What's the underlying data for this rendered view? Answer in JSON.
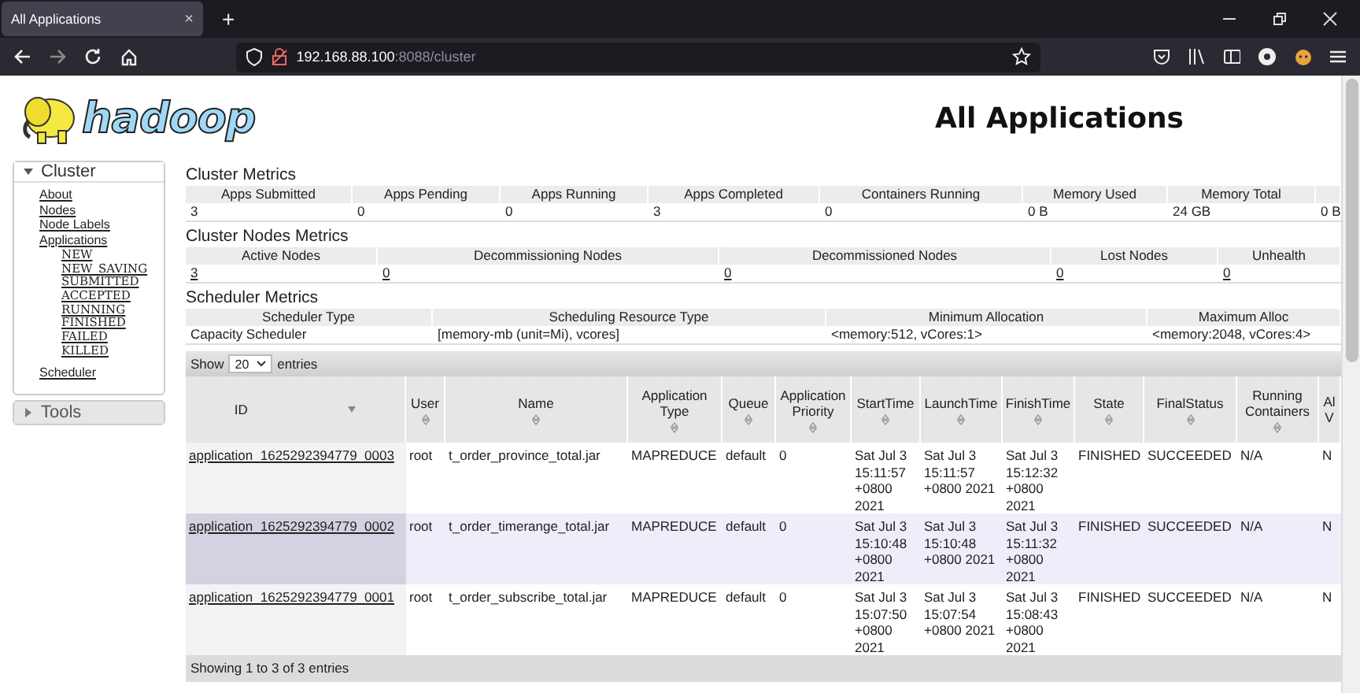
{
  "browser": {
    "tab_title": "All Applications",
    "tab_close": "×",
    "new_tab": "+",
    "url_host": "192.168.88.100",
    "url_path": ":8088/cluster"
  },
  "header": {
    "logo_text": "hadoop",
    "title": "All Applications"
  },
  "sidebar": [
    {
      "label": "Cluster",
      "expanded": true,
      "items": [
        {
          "label": "About"
        },
        {
          "label": "Nodes"
        },
        {
          "label": "Node Labels"
        },
        {
          "label": "Applications",
          "children": [
            {
              "label": "NEW"
            },
            {
              "label": "NEW_SAVING"
            },
            {
              "label": "SUBMITTED"
            },
            {
              "label": "ACCEPTED"
            },
            {
              "label": "RUNNING"
            },
            {
              "label": "FINISHED"
            },
            {
              "label": "FAILED"
            },
            {
              "label": "KILLED"
            }
          ]
        },
        {
          "label": "Scheduler"
        }
      ]
    },
    {
      "label": "Tools",
      "expanded": false
    }
  ],
  "metrics": [
    {
      "title": "Cluster Metrics",
      "columns": [
        "Apps Submitted",
        "Apps Pending",
        "Apps Running",
        "Apps Completed",
        "Containers Running",
        "Memory Used",
        "Memory Total",
        ""
      ],
      "values": [
        "3",
        "0",
        "0",
        "3",
        "0",
        "0 B",
        "24 GB",
        "0 B"
      ],
      "links": false
    },
    {
      "title": "Cluster Nodes Metrics",
      "columns": [
        "Active Nodes",
        "Decommissioning Nodes",
        "Decommissioned Nodes",
        "Lost Nodes",
        "Unhealth"
      ],
      "values": [
        "3",
        "0",
        "0",
        "0",
        "0"
      ],
      "links": true
    },
    {
      "title": "Scheduler Metrics",
      "columns": [
        "Scheduler Type",
        "Scheduling Resource Type",
        "Minimum Allocation",
        "Maximum Alloc"
      ],
      "values": [
        "Capacity Scheduler",
        "[memory-mb (unit=Mi), vcores]",
        "<memory:512, vCores:1>",
        "<memory:2048, vCores:4>"
      ],
      "links": false
    }
  ],
  "apps": {
    "show_label": "Show",
    "page_size": "20",
    "entries_label": "entries",
    "columns": [
      {
        "label": "ID",
        "sorted": true
      },
      {
        "label": "User",
        "sorted": false
      },
      {
        "label": "Name",
        "sorted": false
      },
      {
        "label": "Application Type",
        "sorted": false
      },
      {
        "label": "Queue",
        "sorted": false
      },
      {
        "label": "Application Priority",
        "sorted": false
      },
      {
        "label": "StartTime",
        "sorted": false
      },
      {
        "label": "LaunchTime",
        "sorted": false
      },
      {
        "label": "FinishTime",
        "sorted": false
      },
      {
        "label": "State",
        "sorted": false
      },
      {
        "label": "FinalStatus",
        "sorted": false
      },
      {
        "label": "Running Containers",
        "sorted": false
      },
      {
        "label": "Al V"
      }
    ],
    "rows": [
      {
        "selected": false,
        "cells": [
          "application_1625292394779_0003",
          "root",
          "t_order_province_total.jar",
          "MAPREDUCE",
          "default",
          "0",
          "Sat Jul 3 15:11:57 +0800 2021",
          "Sat Jul 3 15:11:57 +0800 2021",
          "Sat Jul 3 15:12:32 +0800 2021",
          "FINISHED",
          "SUCCEEDED",
          "N/A",
          "N"
        ]
      },
      {
        "selected": true,
        "cells": [
          "application_1625292394779_0002",
          "root",
          "t_order_timerange_total.jar",
          "MAPREDUCE",
          "default",
          "0",
          "Sat Jul 3 15:10:48 +0800 2021",
          "Sat Jul 3 15:10:48 +0800 2021",
          "Sat Jul 3 15:11:32 +0800 2021",
          "FINISHED",
          "SUCCEEDED",
          "N/A",
          "N"
        ]
      },
      {
        "selected": false,
        "cells": [
          "application_1625292394779_0001",
          "root",
          "t_order_subscribe_total.jar",
          "MAPREDUCE",
          "default",
          "0",
          "Sat Jul 3 15:07:50 +0800 2021",
          "Sat Jul 3 15:07:54 +0800 2021",
          "Sat Jul 3 15:08:43 +0800 2021",
          "FINISHED",
          "SUCCEEDED",
          "N/A",
          "N"
        ]
      }
    ],
    "footer": "Showing 1 to 3 of 3 entries"
  }
}
